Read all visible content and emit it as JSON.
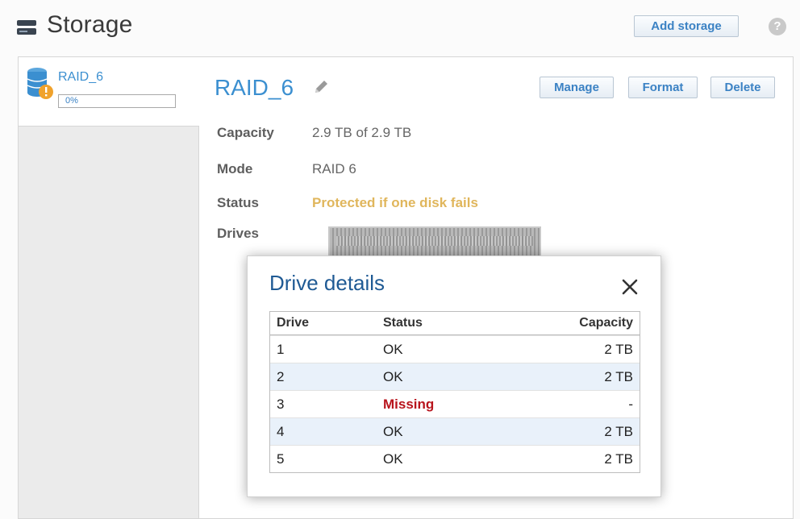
{
  "header": {
    "title": "Storage",
    "title_icon": "drive-stack-icon",
    "add_storage_label": "Add storage",
    "help_icon": "help-icon",
    "help_symbol": "?"
  },
  "sidebar": {
    "volume": {
      "name": "RAID_6",
      "icon": "database-warning-icon",
      "usage_percent_label": "0%",
      "usage_fraction": 0.0
    }
  },
  "detail": {
    "title": "RAID_6",
    "edit_icon": "pencil-icon",
    "buttons": {
      "manage": "Manage",
      "format": "Format",
      "delete": "Delete"
    },
    "fields": {
      "capacity_label": "Capacity",
      "capacity_value": "2.9 TB of 2.9 TB",
      "mode_label": "Mode",
      "mode_value": "RAID 6",
      "status_label": "Status",
      "status_value": "Protected if one disk fails",
      "drives_label": "Drives"
    }
  },
  "modal": {
    "title": "Drive details",
    "close_icon": "close-icon",
    "columns": [
      "Drive",
      "Status",
      "Capacity"
    ],
    "rows": [
      {
        "drive": "1",
        "status": "OK",
        "capacity": "2 TB"
      },
      {
        "drive": "2",
        "status": "OK",
        "capacity": "2 TB"
      },
      {
        "drive": "3",
        "status": "Missing",
        "capacity": "-"
      },
      {
        "drive": "4",
        "status": "OK",
        "capacity": "2 TB"
      },
      {
        "drive": "5",
        "status": "OK",
        "capacity": "2 TB"
      }
    ]
  },
  "colors": {
    "accent": "#3b8fd0",
    "status_warning": "#e0b65c",
    "missing": "#b8151d",
    "modal_title": "#1f5a94",
    "row_alt": "#e9f1fa"
  }
}
